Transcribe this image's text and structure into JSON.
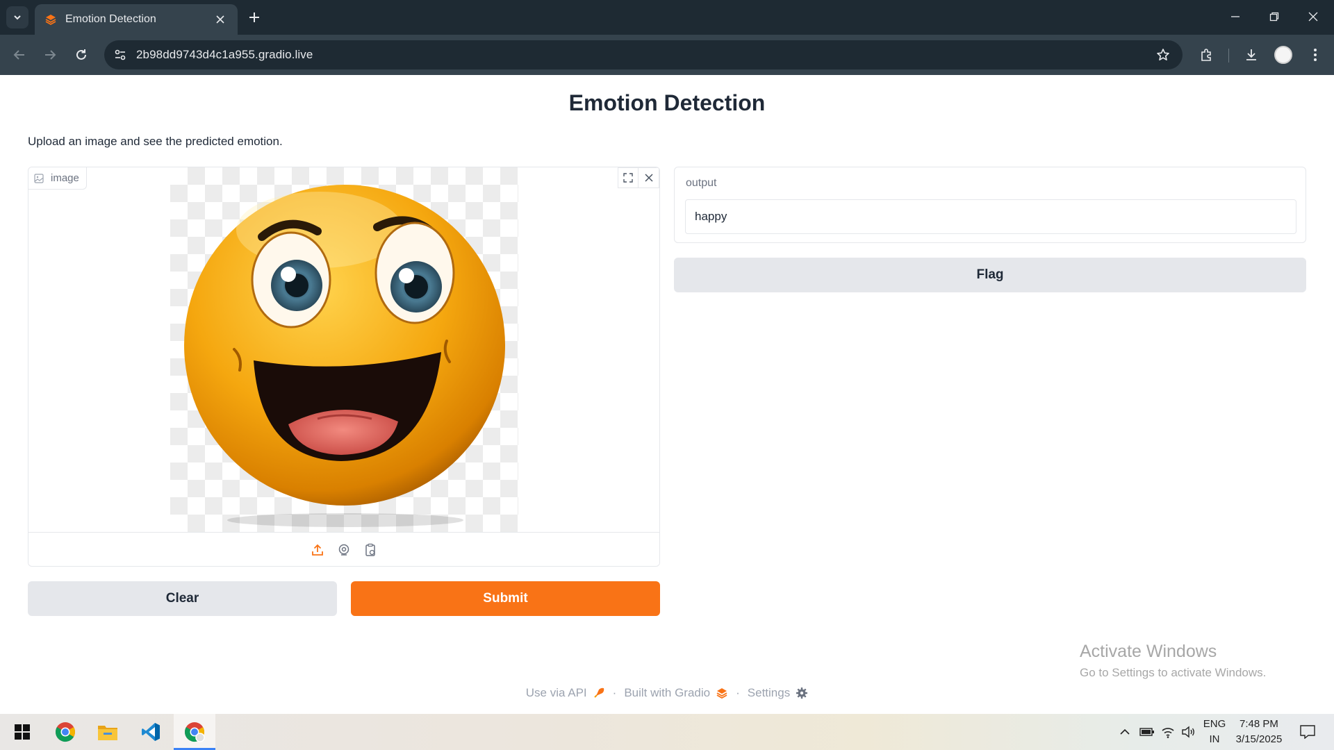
{
  "browser": {
    "tab_title": "Emotion Detection",
    "url": "2b98dd9743d4c1a955.gradio.live"
  },
  "page": {
    "title": "Emotion Detection",
    "description": "Upload an image and see the predicted emotion."
  },
  "input_image": {
    "label": "image",
    "content": "smiling-emoji-face",
    "source_icons": [
      "upload-icon",
      "webcam-icon",
      "clipboard-icon"
    ]
  },
  "output": {
    "label": "output",
    "value": "happy"
  },
  "buttons": {
    "clear": "Clear",
    "submit": "Submit",
    "flag": "Flag"
  },
  "footer": {
    "api": "Use via API",
    "built": "Built with Gradio",
    "settings": "Settings",
    "separator": "·"
  },
  "watermark": {
    "title": "Activate Windows",
    "subtitle": "Go to Settings to activate Windows."
  },
  "taskbar": {
    "apps": [
      "windows-start-icon",
      "chrome-icon",
      "file-explorer-icon",
      "vscode-icon",
      "chrome-active-icon"
    ],
    "lang_line1": "ENG",
    "lang_line2": "IN",
    "time": "7:48 PM",
    "date": "3/15/2025"
  },
  "colors": {
    "accent": "#f97316",
    "chrome_dark": "#1e2a33",
    "chrome_toolbar": "#35434d"
  }
}
